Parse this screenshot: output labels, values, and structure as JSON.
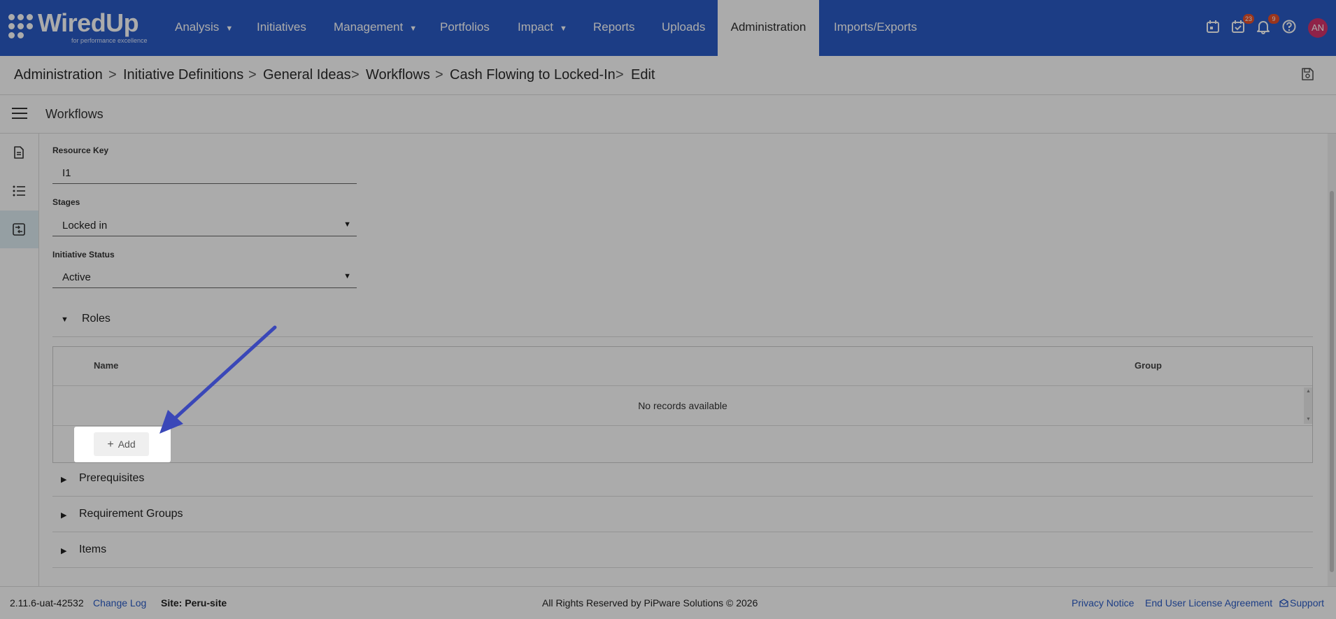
{
  "app": {
    "logo_name": "WiredUp",
    "logo_tagline": "for performance excellence"
  },
  "nav": {
    "items": [
      {
        "label": "Analysis",
        "caret": "▼"
      },
      {
        "label": "Initiatives"
      },
      {
        "label": "Management",
        "caret": "▼"
      },
      {
        "label": "Portfolios"
      },
      {
        "label": "Impact",
        "caret": "▼"
      },
      {
        "label": "Reports"
      },
      {
        "label": "Uploads"
      },
      {
        "label": "Administration"
      },
      {
        "label": "Imports/Exports"
      }
    ],
    "tasks_badge": "23",
    "notifications_badge": "9",
    "avatar_initials": "AN",
    "icons": [
      "calendar-icon",
      "tasks-icon",
      "bell-icon",
      "help-icon"
    ]
  },
  "breadcrumb": [
    "Administration",
    "Initiative Definitions",
    "General Ideas",
    "Workflows",
    "Cash Flowing to Locked-In",
    "Edit"
  ],
  "breadcrumb_separator": ">",
  "section": {
    "title": "Workflows"
  },
  "form": {
    "resource_key_label": "Resource Key",
    "resource_key_value": "I1",
    "stages_label": "Stages",
    "stages_value": "Locked in",
    "status_label": "Initiative Status",
    "status_value": "Active"
  },
  "panels": {
    "roles": "Roles",
    "prerequisites": "Prerequisites",
    "requirement_groups": "Requirement Groups",
    "items": "Items"
  },
  "grid": {
    "columns": [
      "Name",
      "Group"
    ],
    "empty_text": "No records available",
    "add_label": "Add"
  },
  "footer": {
    "version": "2.11.6-uat-42532",
    "change_log": "Change Log",
    "site": "Site: Peru-site",
    "copyright": "All Rights Reserved by PiPware Solutions © 2026",
    "privacy": "Privacy Notice",
    "eula": "End User License Agreement",
    "support": "Support"
  },
  "colors": {
    "nav_bg": "#2a5cc6",
    "active_rail": "#dfeef4",
    "arrow": "#3a47b8",
    "badge": "#e8502a",
    "avatar": "#d6336c"
  }
}
